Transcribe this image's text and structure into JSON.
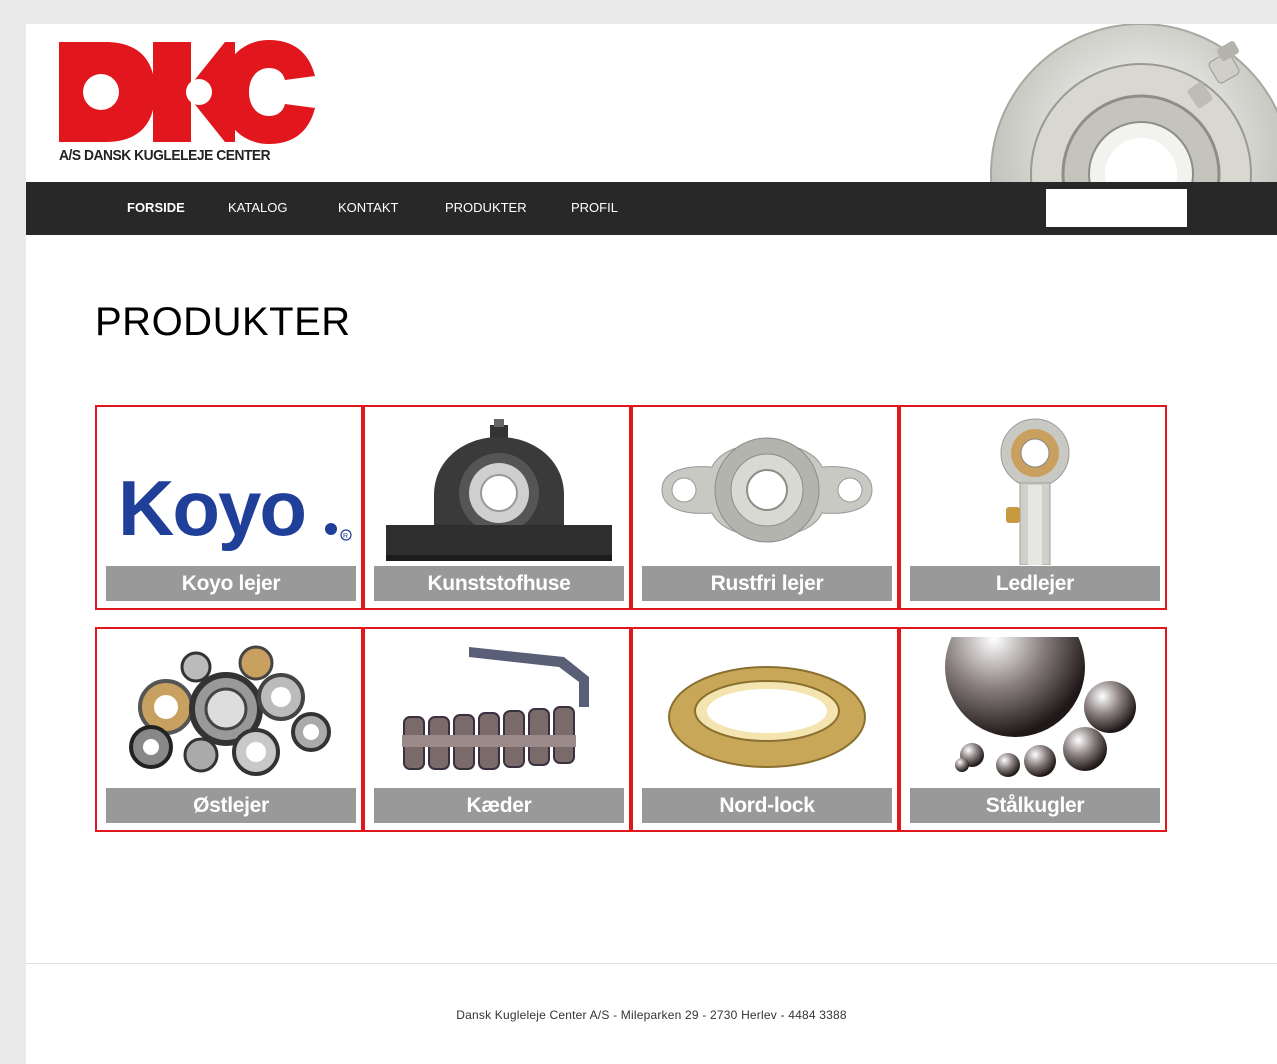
{
  "header": {
    "logo_text": "DKC",
    "logo_subtitle": "A/S DANSK KUGLELEJE CENTER"
  },
  "nav": {
    "items": [
      {
        "label": "FORSIDE",
        "active": true
      },
      {
        "label": "KATALOG",
        "active": false
      },
      {
        "label": "KONTAKT",
        "active": false
      },
      {
        "label": "PRODUKTER",
        "active": false
      },
      {
        "label": "PROFIL",
        "active": false
      }
    ],
    "search_value": ""
  },
  "main": {
    "title": "PRODUKTER",
    "products": [
      {
        "label": "Koyo lejer",
        "brand": "Koyo"
      },
      {
        "label": "Kunststofhuse"
      },
      {
        "label": "Rustfri lejer"
      },
      {
        "label": "Ledlejer"
      },
      {
        "label": "Østlejer"
      },
      {
        "label": "Kæder"
      },
      {
        "label": "Nord-lock"
      },
      {
        "label": "Stålkugler"
      }
    ]
  },
  "footer": {
    "text": "Dansk Kugleleje Center A/S - Mileparken 29 - 2730 Herlev - 4484 3388"
  },
  "colors": {
    "brand_red": "#e2161d",
    "nav_bg": "#282828",
    "label_bg": "#999999",
    "koyo_blue": "#1f3f99"
  }
}
